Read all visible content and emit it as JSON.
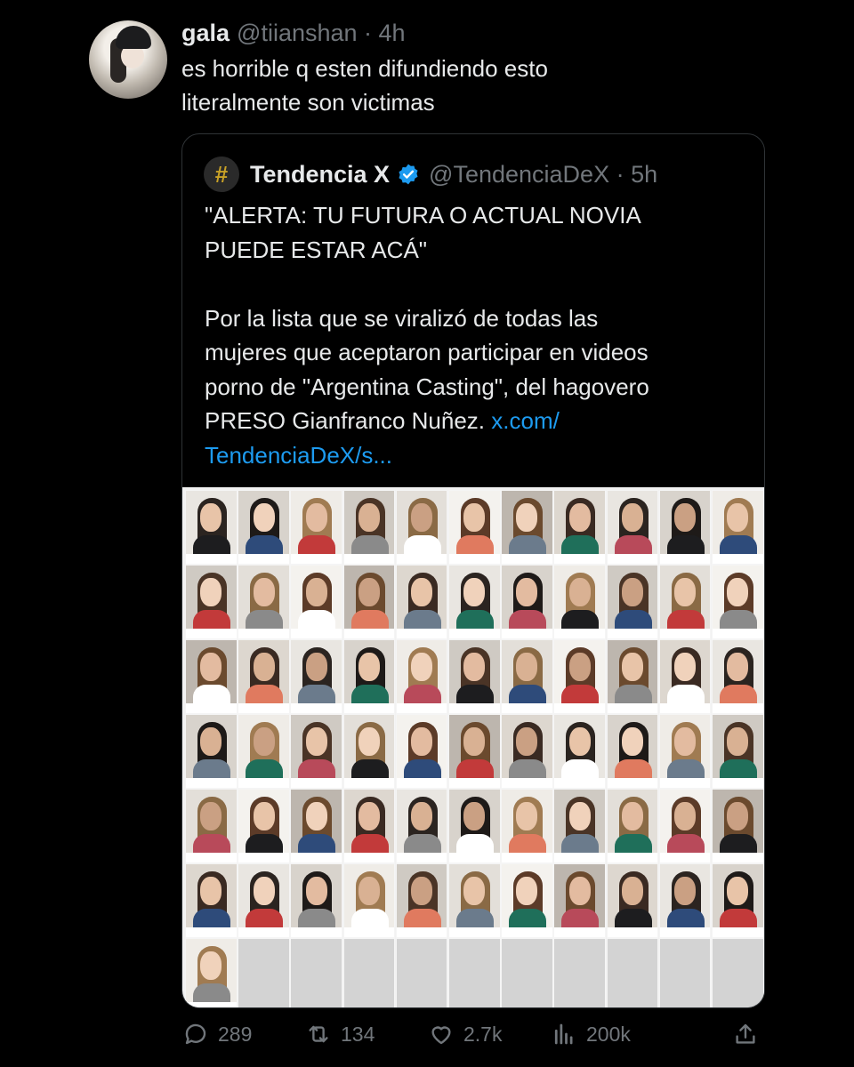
{
  "tweet": {
    "name": "gala",
    "handle": "@tiianshan",
    "time": "4h",
    "text_line1": "es horrible q esten difundiendo esto",
    "text_line2": "literalmente son victimas"
  },
  "quoted": {
    "avatar_glyph": "#",
    "name": "Tendencia X",
    "handle": "@TendenciaDeX",
    "time": "5h",
    "body": "\"ALERTA: TU FUTURA O ACTUAL NOVIA\nPUEDE ESTAR ACÁ\"\n\nPor la lista que se viralizó de todas las\nmujeres que aceptaron participar en videos\nporno de \"Argentina Casting\", del hagovero\nPRESO Gianfranco Nuñez. ",
    "link": "x.com/\nTendenciaDeX/s...",
    "media_grid": {
      "columns": 11,
      "photo_count": 67,
      "empty_count": 10
    }
  },
  "actions": {
    "replies": "289",
    "reposts": "134",
    "likes": "2.7k",
    "views": "200k"
  },
  "icons": [
    "reply-icon",
    "repost-icon",
    "like-icon",
    "views-icon",
    "share-icon",
    "verified-icon"
  ],
  "colors": {
    "background": "#000000",
    "text": "#e7e9ea",
    "muted": "#71767b",
    "link": "#1d9bf0",
    "border": "#2f3336"
  }
}
